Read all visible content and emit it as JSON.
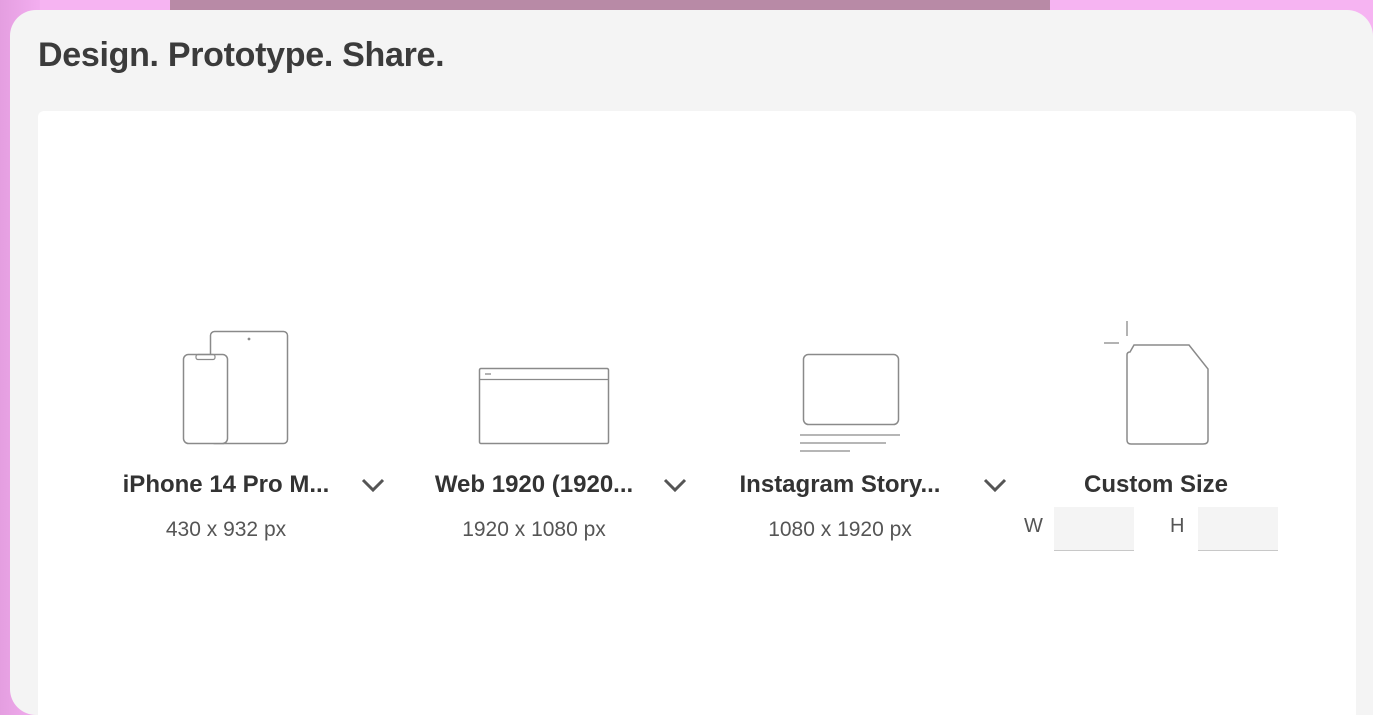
{
  "window": {
    "title": "Design. Prototype. Share."
  },
  "presets": [
    {
      "name": "iPhone 14 Pro M...",
      "dims": "430 x 932 px",
      "icon": "iphone-ipad-icon"
    },
    {
      "name": "Web 1920 (1920...",
      "dims": "1920 x 1080 px",
      "icon": "web-browser-icon"
    },
    {
      "name": "Instagram Story...",
      "dims": "1080 x 1920 px",
      "icon": "instagram-story-icon"
    }
  ],
  "custom": {
    "label": "Custom Size",
    "width_letter": "W",
    "height_letter": "H",
    "width_value": "",
    "height_value": "",
    "icon": "custom-size-icon"
  },
  "colors": {
    "background": "#f5b0f0",
    "window": "#f4f4f4",
    "panel": "#ffffff",
    "text": "#333333",
    "icon_stroke": "#8a8a8a"
  }
}
